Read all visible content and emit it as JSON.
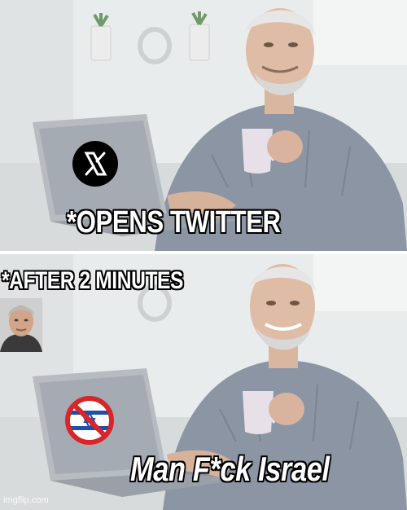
{
  "meme": {
    "template": "Hide the Pain Harold",
    "top_caption": "*OPENS TWITTER",
    "middle_caption": "*AFTER 2 MINUTES",
    "bottom_caption": "Man F*ck Israel",
    "watermark": "imgflip.com"
  },
  "icons": {
    "top_panel_logo": "x-logo-icon",
    "bottom_panel_symbol": "no-israel-flag-icon",
    "bottom_panel_portrait": "man-portrait-photo"
  },
  "colors": {
    "caption_fill": "#ffffff",
    "caption_outline": "#000000",
    "prohibition_red": "#d9252a",
    "flag_blue": "#1f4fa8"
  }
}
